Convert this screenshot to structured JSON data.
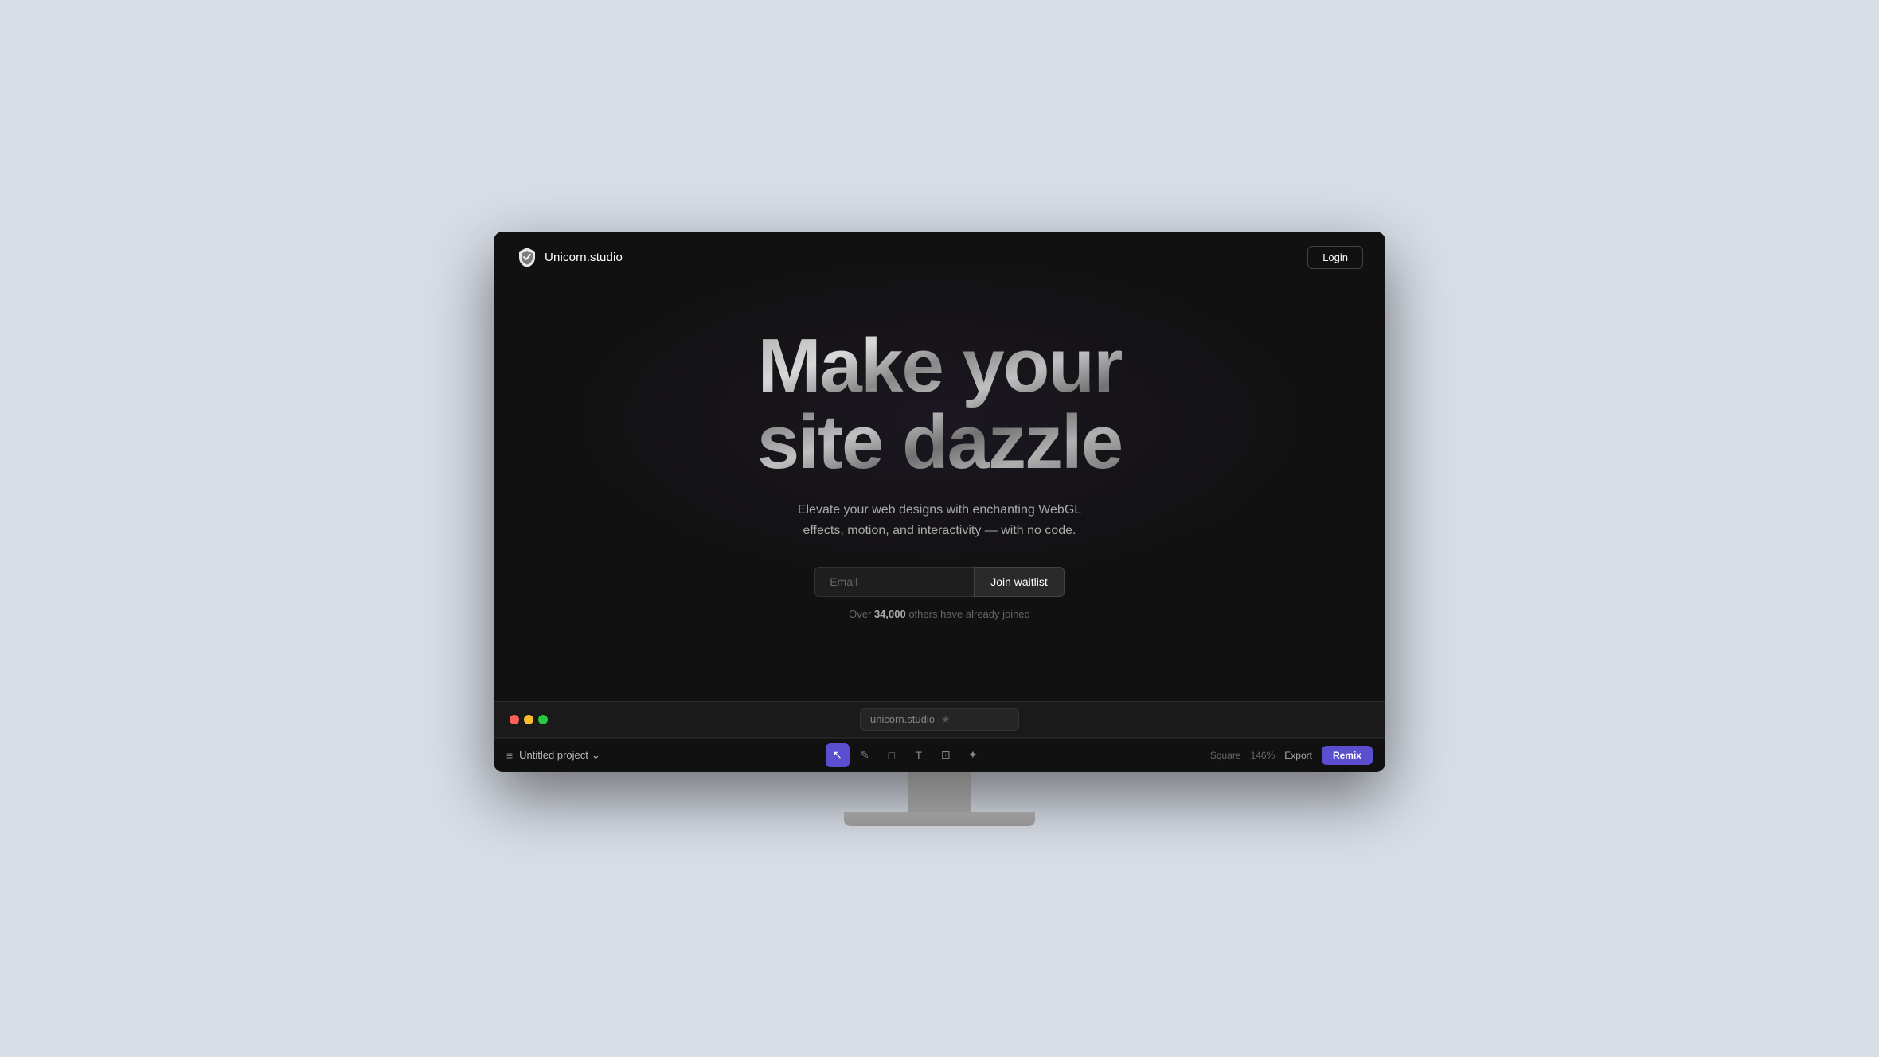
{
  "app": {
    "logo_text": "Unicorn.studio",
    "login_label": "Login"
  },
  "hero": {
    "title_line1": "Make your",
    "title_line2": "site dazzle",
    "subtitle": "Elevate your web designs with enchanting WebGL effects, motion, and interactivity — with no code.",
    "email_placeholder": "Email",
    "cta_button_label": "Join waitlist",
    "social_proof_text": "Over ",
    "social_proof_count": "34,000",
    "social_proof_suffix": " others have already joined"
  },
  "url_bar": {
    "url": "unicorn.studio",
    "star_icon": "★"
  },
  "toolbar": {
    "project_name": "Untitled project",
    "shape_label": "Square",
    "zoom_label": "146%",
    "export_label": "Export",
    "remix_label": "Remix"
  },
  "traffic_lights": {
    "red": "#ff5f57",
    "yellow": "#febc2e",
    "green": "#28c840"
  },
  "icons": {
    "menu": "≡",
    "chevron_down": "⌄",
    "cursor": "↖",
    "pen": "✎",
    "rect": "□",
    "text": "T",
    "image": "⊡",
    "shapes": "✦"
  }
}
